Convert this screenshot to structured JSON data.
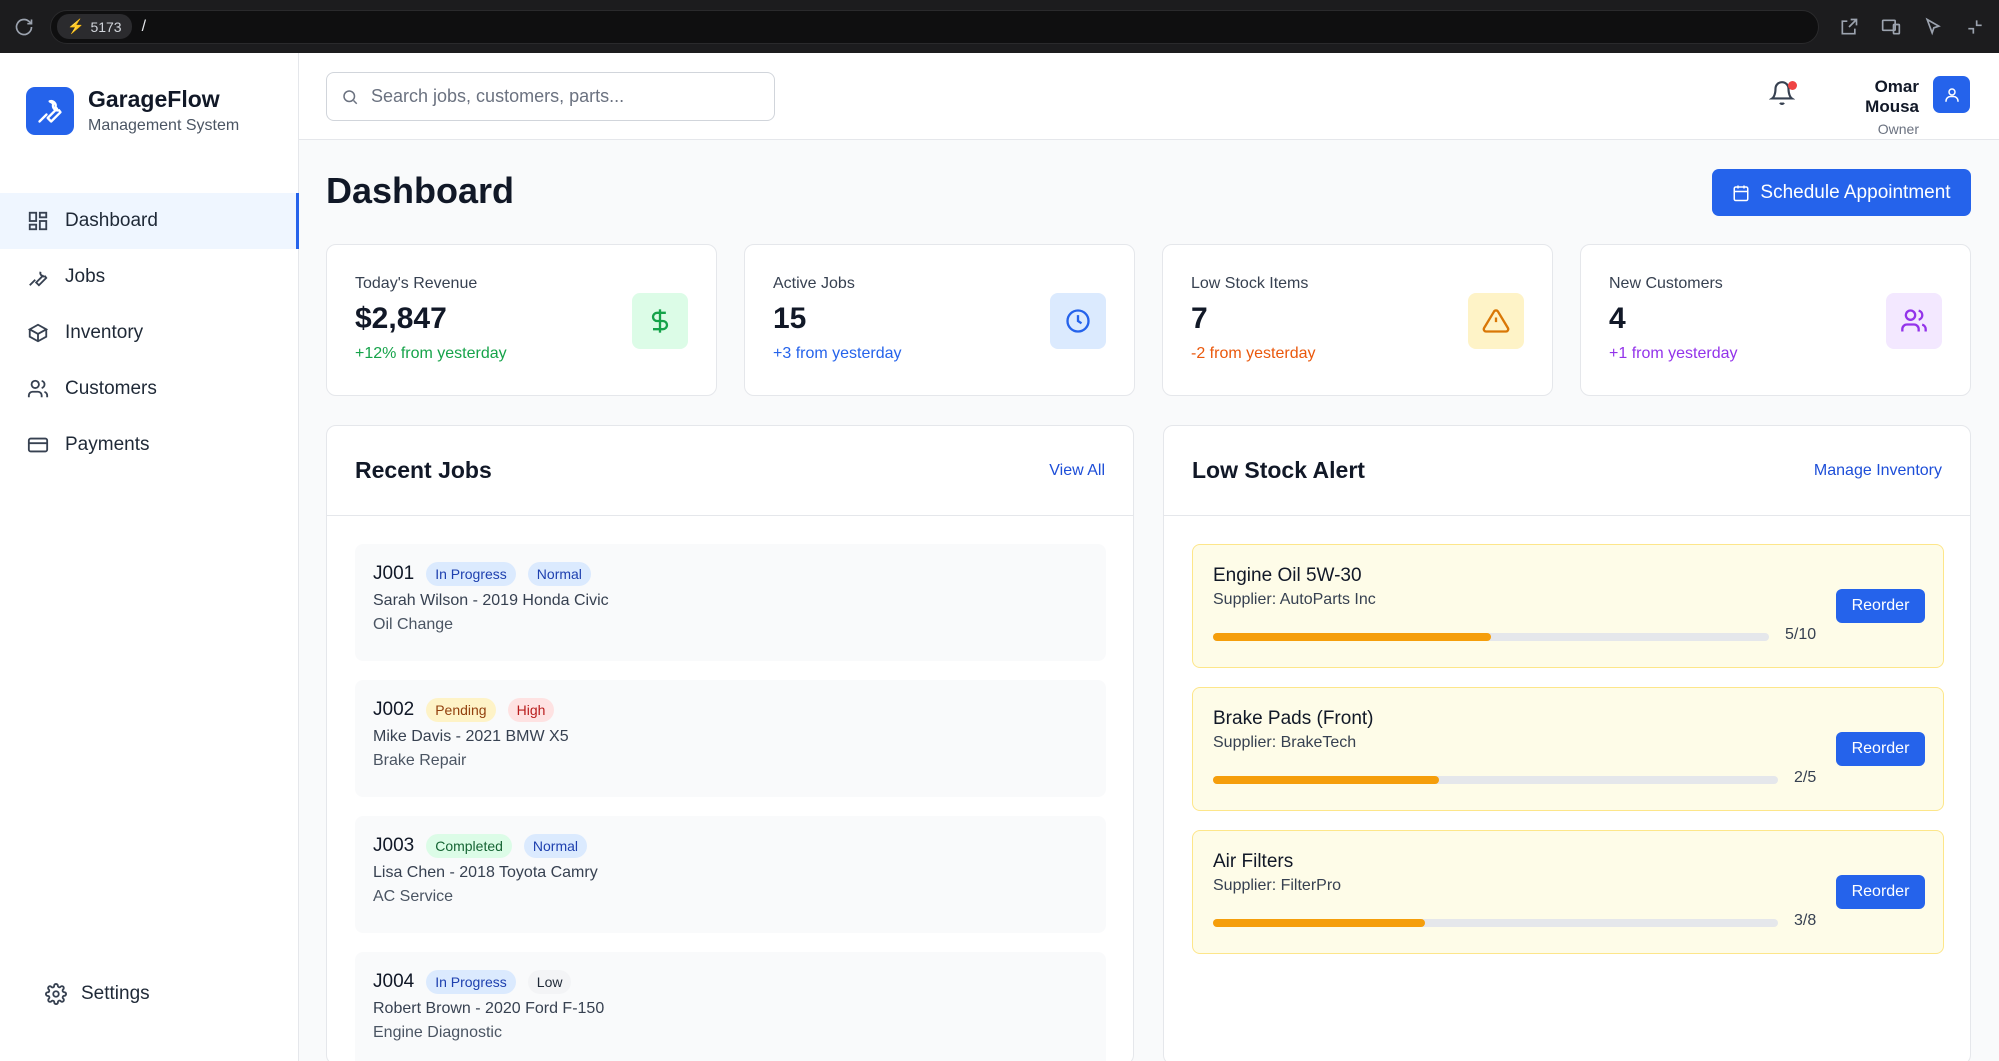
{
  "browser": {
    "port": "5173",
    "path": "/"
  },
  "brand": {
    "name": "GarageFlow",
    "subtitle": "Management System"
  },
  "nav": [
    {
      "label": "Dashboard",
      "icon": "dashboard-icon",
      "active": true
    },
    {
      "label": "Jobs",
      "icon": "wrench-icon"
    },
    {
      "label": "Inventory",
      "icon": "box-icon"
    },
    {
      "label": "Customers",
      "icon": "users-icon"
    },
    {
      "label": "Payments",
      "icon": "credit-card-icon"
    }
  ],
  "settings_label": "Settings",
  "search": {
    "placeholder": "Search jobs, customers, parts..."
  },
  "user": {
    "name": "Omar Mousa",
    "role": "Owner"
  },
  "page": {
    "title": "Dashboard",
    "primary_action": "Schedule Appointment"
  },
  "stats": [
    {
      "label": "Today's Revenue",
      "value": "$2,847",
      "delta": "+12% from yesterday",
      "color": "#16a34a",
      "icon": "dollar-icon",
      "icon_bg": "#dcfce7"
    },
    {
      "label": "Active Jobs",
      "value": "15",
      "delta": "+3 from yesterday",
      "color": "#2563eb",
      "icon": "clock-icon",
      "icon_bg": "#dbeafe"
    },
    {
      "label": "Low Stock Items",
      "value": "7",
      "delta": "-2 from yesterday",
      "color": "#ea580c",
      "icon": "warning-icon",
      "icon_bg": "#fef3c7"
    },
    {
      "label": "New Customers",
      "value": "4",
      "delta": "+1 from yesterday",
      "color": "#9333ea",
      "icon": "users-icon",
      "icon_bg": "#f3e8ff"
    }
  ],
  "recent_jobs": {
    "title": "Recent Jobs",
    "link": "View All",
    "items": [
      {
        "id": "J001",
        "status": "In Progress",
        "priority": "Normal",
        "customer": "Sarah Wilson - 2019 Honda Civic",
        "service": "Oil Change"
      },
      {
        "id": "J002",
        "status": "Pending",
        "priority": "High",
        "customer": "Mike Davis - 2021 BMW X5",
        "service": "Brake Repair"
      },
      {
        "id": "J003",
        "status": "Completed",
        "priority": "Normal",
        "customer": "Lisa Chen - 2018 Toyota Camry",
        "service": "AC Service"
      },
      {
        "id": "J004",
        "status": "In Progress",
        "priority": "Low",
        "customer": "Robert Brown - 2020 Ford F-150",
        "service": "Engine Diagnostic"
      }
    ]
  },
  "low_stock": {
    "title": "Low Stock Alert",
    "link": "Manage Inventory",
    "reorder_label": "Reorder",
    "items": [
      {
        "name": "Engine Oil 5W-30",
        "supplier": "Supplier: AutoParts Inc",
        "count": "5/10",
        "level": 0.5
      },
      {
        "name": "Brake Pads (Front)",
        "supplier": "Supplier: BrakeTech",
        "count": "2/5",
        "level": 0.4
      },
      {
        "name": "Air Filters",
        "supplier": "Supplier: FilterPro",
        "count": "3/8",
        "level": 0.375
      }
    ]
  }
}
